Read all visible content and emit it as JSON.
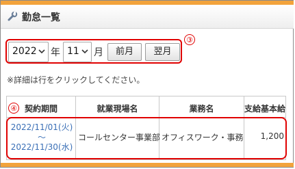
{
  "header": {
    "title": "勤怠一覧",
    "icon": "wrench-icon"
  },
  "filters": {
    "year_value": "2022",
    "year_label": "年",
    "month_value": "11",
    "month_label": "月",
    "prev_button": "前月",
    "next_button": "翌月"
  },
  "annotations": {
    "marker_filters": "③",
    "marker_row": "④"
  },
  "note": "※詳細は行をクリックしてください。",
  "table": {
    "columns": [
      "契約期間",
      "就業現場名",
      "業務名",
      "支給基本給"
    ],
    "rows": [
      {
        "period_start": "2022/11/01(火)",
        "period_sep": "～",
        "period_end": "2022/11/30(水)",
        "site": "コールセンター事業部",
        "job": "オフィスワーク・事務",
        "pay": "1,200"
      }
    ]
  },
  "colors": {
    "accent_orange": "#f2a33c",
    "annotation_red": "#e00000",
    "link_blue": "#3a6fb6"
  }
}
